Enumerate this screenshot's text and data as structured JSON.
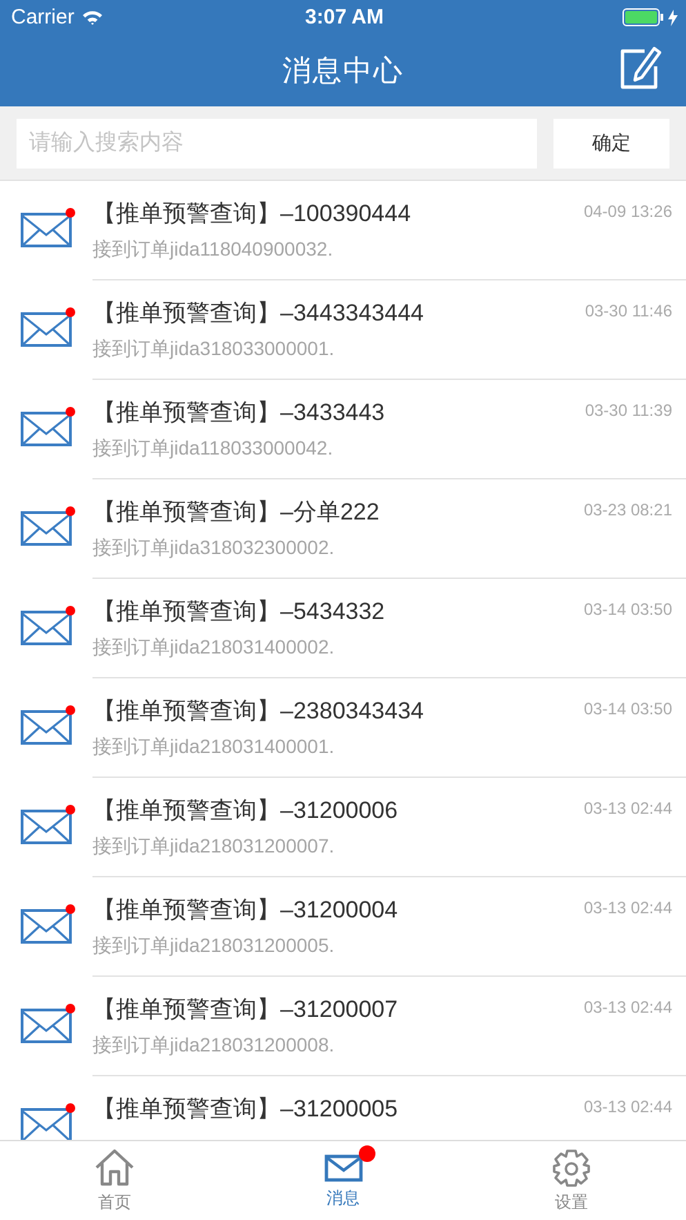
{
  "status_bar": {
    "carrier": "Carrier",
    "time": "3:07 AM"
  },
  "nav": {
    "title": "消息中心"
  },
  "search": {
    "placeholder": "请输入搜索内容",
    "button": "确定"
  },
  "messages": [
    {
      "title": "【推单预警查询】–100390444",
      "preview": "接到订单jida118040900032.",
      "time": "04-09 13:26",
      "unread": true
    },
    {
      "title": "【推单预警查询】–3443343444",
      "preview": "接到订单jida318033000001.",
      "time": "03-30 11:46",
      "unread": true
    },
    {
      "title": "【推单预警查询】–3433443",
      "preview": "接到订单jida118033000042.",
      "time": "03-30 11:39",
      "unread": true
    },
    {
      "title": "【推单预警查询】–分单222",
      "preview": "接到订单jida318032300002.",
      "time": "03-23 08:21",
      "unread": true
    },
    {
      "title": "【推单预警查询】–5434332",
      "preview": "接到订单jida218031400002.",
      "time": "03-14 03:50",
      "unread": true
    },
    {
      "title": "【推单预警查询】–2380343434",
      "preview": "接到订单jida218031400001.",
      "time": "03-14 03:50",
      "unread": true
    },
    {
      "title": "【推单预警查询】–31200006",
      "preview": "接到订单jida218031200007.",
      "time": "03-13 02:44",
      "unread": true
    },
    {
      "title": "【推单预警查询】–31200004",
      "preview": "接到订单jida218031200005.",
      "time": "03-13 02:44",
      "unread": true
    },
    {
      "title": "【推单预警查询】–31200007",
      "preview": "接到订单jida218031200008.",
      "time": "03-13 02:44",
      "unread": true
    },
    {
      "title": "【推单预警查询】–31200005",
      "time": "03-13 02:44",
      "unread": true
    }
  ],
  "tabs": [
    {
      "kind": "home",
      "label": "首页",
      "selected": false,
      "badge": false
    },
    {
      "kind": "message",
      "label": "消息",
      "selected": true,
      "badge": true
    },
    {
      "kind": "settings",
      "label": "设置",
      "selected": false,
      "badge": false
    }
  ]
}
